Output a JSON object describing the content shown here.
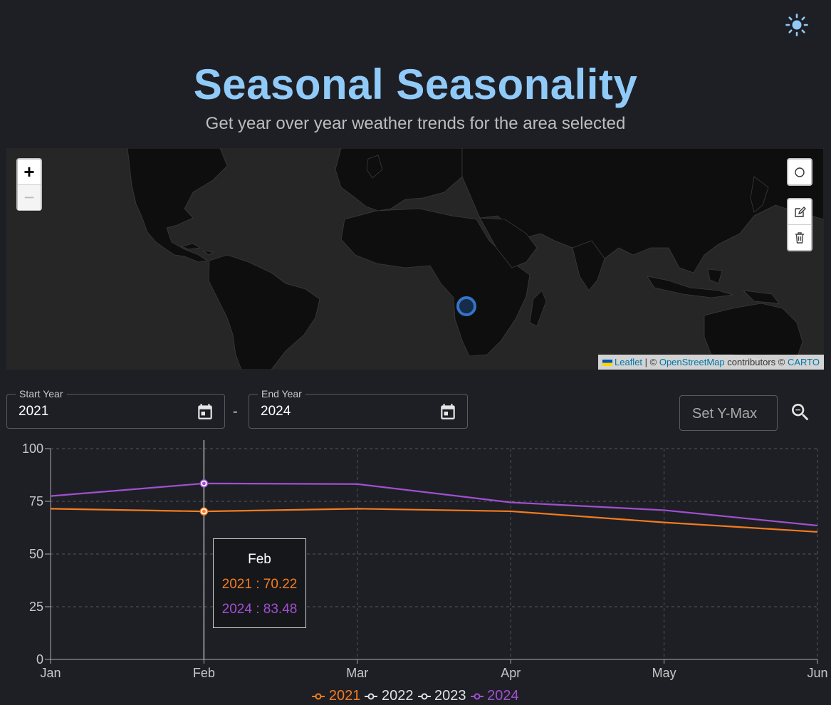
{
  "header": {
    "title": "Seasonal Seasonality",
    "subtitle": "Get year over year weather trends for the area selected",
    "theme_icon": "sun-icon"
  },
  "map": {
    "zoom_in": "+",
    "zoom_out": "−",
    "attribution": {
      "leaflet": "Leaflet",
      "sep1": " | © ",
      "osm": "OpenStreetMap",
      "contrib": " contributors © ",
      "carto": "CARTO"
    },
    "tools": [
      "circle-draw-icon",
      "edit-icon",
      "trash-icon"
    ]
  },
  "controls": {
    "start_year": {
      "label": "Start Year",
      "value": "2021"
    },
    "end_year": {
      "label": "End Year",
      "value": "2024"
    },
    "separator": "-",
    "ymax_placeholder": "Set Y-Max"
  },
  "tooltip": {
    "title": "Feb",
    "rows": [
      {
        "text": "2021 : 70.22",
        "color": "#f57c1f"
      },
      {
        "text": "2024 : 83.48",
        "color": "#a050d0"
      }
    ]
  },
  "chart_data": {
    "type": "line",
    "categories": [
      "Jan",
      "Feb",
      "Mar",
      "Apr",
      "May",
      "Jun"
    ],
    "ylim": [
      0,
      100
    ],
    "yticks": [
      0,
      25,
      50,
      75,
      100
    ],
    "grid": true,
    "legend_position": "bottom",
    "series": [
      {
        "name": "2021",
        "color": "#f57c1f",
        "values": [
          71.5,
          70.22,
          71.5,
          70.3,
          65,
          60.5
        ]
      },
      {
        "name": "2022",
        "color": "#e0e0e0",
        "values": []
      },
      {
        "name": "2023",
        "color": "#e0e0e0",
        "values": []
      },
      {
        "name": "2024",
        "color": "#a050d0",
        "values": [
          77.5,
          83.48,
          83.2,
          74.5,
          70.8,
          63.5
        ]
      }
    ],
    "highlight_category": "Feb"
  }
}
